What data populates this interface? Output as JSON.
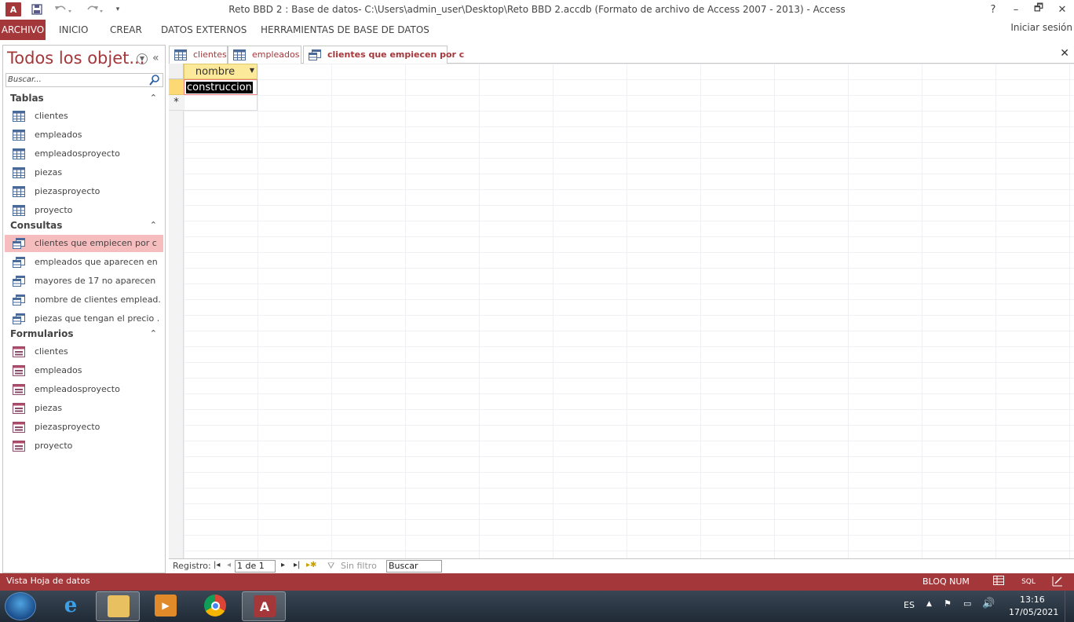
{
  "window": {
    "title": "Reto BBD 2 : Base de datos- C:\\Users\\admin_user\\Desktop\\Reto BBD 2.accdb (Formato de archivo de Access 2007 - 2013) - Access",
    "logo": "A",
    "help": "?",
    "minimize": "–",
    "restore": "🗗",
    "close": "✕"
  },
  "ribbon": {
    "tabs": [
      "ARCHIVO",
      "INICIO",
      "CREAR",
      "DATOS EXTERNOS",
      "HERRAMIENTAS DE BASE DE DATOS"
    ],
    "signin": "Iniciar sesión"
  },
  "nav": {
    "title": "Todos los objet...",
    "search_placeholder": "Buscar...",
    "groups": [
      {
        "label": "Tablas",
        "items": [
          "clientes",
          "empleados",
          "empleadosproyecto",
          "piezas",
          "piezasproyecto",
          "proyecto"
        ]
      },
      {
        "label": "Consultas",
        "items": [
          "clientes que empiecen por c",
          "empleados que aparecen en ...",
          "mayores de 17 no aparecen",
          "nombre de clientes emplead...",
          "piezas que tengan el precio ..."
        ]
      },
      {
        "label": "Formularios",
        "items": [
          "clientes",
          "empleados",
          "empleadosproyecto",
          "piezas",
          "piezasproyecto",
          "proyecto"
        ]
      }
    ],
    "selected": "clientes que empiecen por c"
  },
  "doc_tabs": [
    {
      "label": "clientes",
      "icon": "table-icon"
    },
    {
      "label": "empleados",
      "icon": "table-icon"
    },
    {
      "label": "clientes que empiecen por c",
      "icon": "query-icon",
      "active": true
    }
  ],
  "datasheet": {
    "column": "nombre",
    "rows": [
      "construccion"
    ],
    "new_row_marker": "*"
  },
  "record_nav": {
    "label": "Registro:",
    "position": "1 de 1",
    "filter": "Sin filtro",
    "search": "Buscar"
  },
  "status": {
    "left": "Vista Hoja de datos",
    "numlock": "BLOQ NUM",
    "sql": "SQL"
  },
  "taskbar": {
    "lang": "ES",
    "time": "13:16",
    "date": "17/05/2021"
  },
  "colors": {
    "accent": "#a4373a",
    "selection": "#f6bdbf",
    "header": "#fde99a"
  }
}
